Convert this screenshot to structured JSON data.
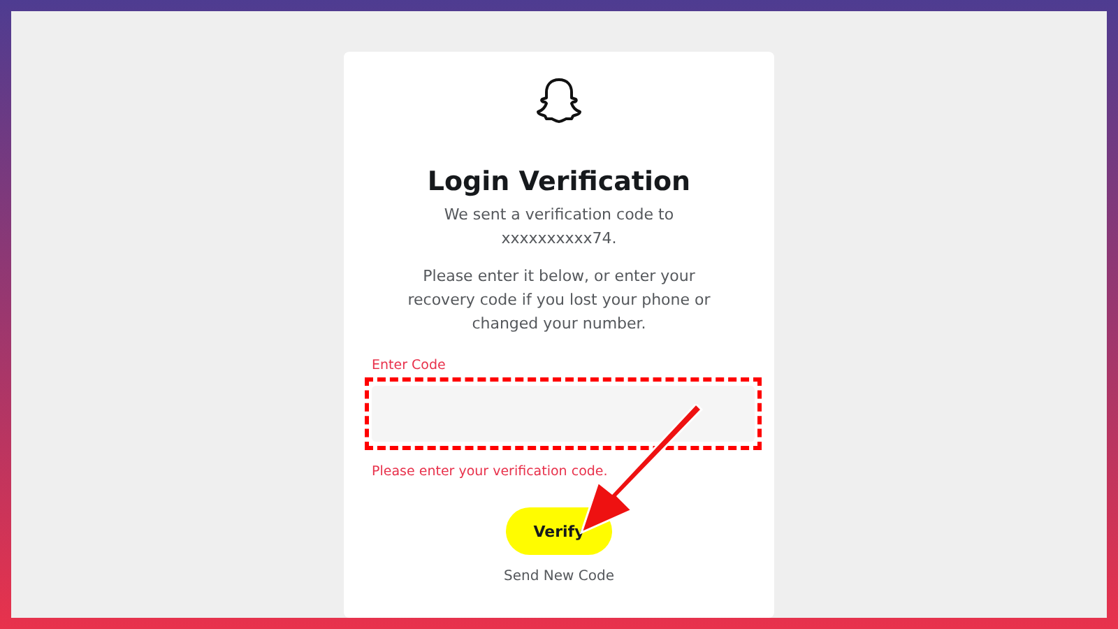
{
  "card": {
    "title": "Login Verification",
    "sent_text": "We sent a verification code to",
    "phone": "xxxxxxxxxx74.",
    "instructions": "Please enter it below, or enter your recovery code if you lost your phone or changed your number.",
    "field": {
      "label": "Enter Code",
      "invalid": true,
      "error": "Please enter your verification code."
    },
    "verify_button": "Verify",
    "resend_link": "Send New Code"
  }
}
